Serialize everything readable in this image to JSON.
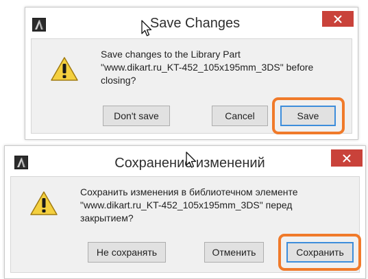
{
  "dialogs": [
    {
      "title": "Save Changes",
      "message_lines": [
        "Save changes to the Library Part",
        "\"www.dikart.ru_KT-452_105x195mm_3DS\" before",
        "closing?"
      ],
      "buttons": {
        "dont_save": "Don't save",
        "cancel": "Cancel",
        "save": "Save"
      },
      "default_button": "save",
      "highlighted_button": "save"
    },
    {
      "title": "Сохранение изменений",
      "message_lines": [
        "Сохранить изменения в библиотечном элементе",
        "\"www.dikart.ru_KT-452_105x195mm_3DS\" перед",
        "закрытием?"
      ],
      "buttons": {
        "dont_save": "Не сохранять",
        "cancel": "Отменить",
        "save": "Сохранить"
      },
      "default_button": "save",
      "highlighted_button": "save"
    }
  ],
  "colors": {
    "close_button": "#c9423a",
    "highlight": "#f07a2a",
    "default_button_border": "#3c8ddb",
    "warning_fill": "#f4d03f"
  },
  "icons": {
    "app": "archicad-app-icon",
    "warning": "warning-icon",
    "close": "close-icon",
    "cursor": "mouse-pointer-icon"
  }
}
